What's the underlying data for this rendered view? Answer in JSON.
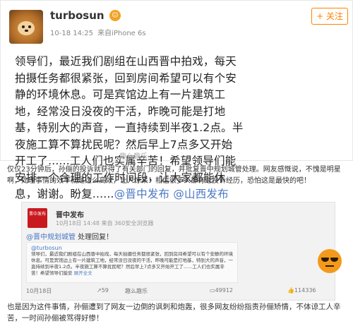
{
  "post": {
    "username": "turbosun",
    "badge_icon": "smiley-badge-icon",
    "time": "10-18 14:25",
    "source": "来自iPhone 6s",
    "follow_label": "+ 关注",
    "body_lines": [
      "领导们，最近我们剧组在山西晋中拍戏，每天",
      "拍摄任务都很紧张，回到房间希望可以有个安",
      "静的环境休息。可是宾馆边上有一片建筑工",
      "地，经常没日没夜的干活，昨晚可能是打地",
      "基，特别大的声音，一直持续到半夜1.2点。半",
      "夜施工算不算扰民呢？然后早上7点多又开始",
      "开工了......工人们也实属辛苦！希望领导们能",
      "安排一个合理的工作时间段，让大家都能休",
      "息，谢谢。盼复......"
    ],
    "mention_1": "@晋中发布",
    "mention_2": "@山西发布",
    "watermark": "趣么趣乐"
  },
  "caption": "仅仅23分钟后，孙俪的投诉就获得了有关部门的回复，并批复晋中规划城管处理。网友感慨说，不愧是明星啊，处理事情的效率就是这么高效，让人惊呆！相信很多人都有过投诉经历，恐怕这是最快的吧！",
  "repost": {
    "avatar_text": "晋中发布",
    "name": "晋中发布",
    "time": "10月18日 14:48",
    "source": "来自 360安全浏览器",
    "reply_mention": "@晋中规划城管",
    "reply_text": " 处理回复！",
    "quoted_name": "@turbosun",
    "quoted_text": "领导们，最近我们剧组在山西晋中拍戏，每天拍摄任务都很紧张，回到房间希望可以有个安静的环境休息。可是宾馆边上有一片建筑工地，经常没日没夜的干活，昨晚可能是打地基，特别大的声音，一直持续到半夜1.2点。半夜施工算不算扰民呢？然后早上7点多又开始开工了......工人们也实属辛苦！希望领导们能安",
    "quoted_full": "展开全文",
    "stats_time": "10月18日",
    "stats_reposts": "59",
    "stats_comments": "49912",
    "stats_likes": "114336",
    "watermark": "趣么趣乐"
  },
  "bottom_text": "也是因为这件事情，孙俪遭到了网友一边倒的讽刺和炮轰，很多网友纷纷指责孙俪矫情，不体谅工人辛苦，一时间孙俪被骂得好惨！",
  "colors": {
    "accent": "#ff8200",
    "link": "#4a78c4",
    "repost_bg": "#f2f2f2"
  }
}
